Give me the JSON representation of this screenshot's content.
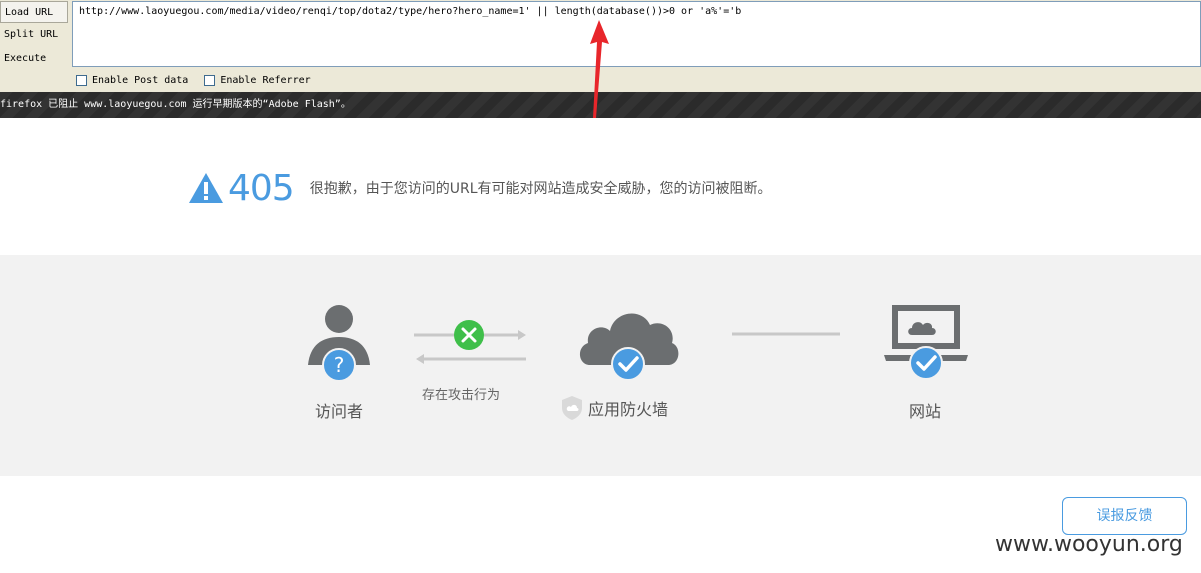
{
  "hackbar": {
    "load_url": "Load URL",
    "split_url": "Split URL",
    "execute": "Execute",
    "url_value": "http://www.laoyuegou.com/media/video/renqi/top/dota2/type/hero?hero_name=1'  || length(database())>0 or  'a%'='b",
    "enable_post": "Enable Post data",
    "enable_referrer": "Enable Referrer"
  },
  "flash_notice": "firefox 已阻止 www.laoyuegou.com 运行早期版本的“Adobe Flash”。",
  "error": {
    "code": "405",
    "message": "很抱歉，由于您访问的URL有可能对网站造成安全威胁，您的访问被阻断。"
  },
  "diagram": {
    "visitor_label": "访问者",
    "attack_label": "存在攻击行为",
    "firewall_label": "应用防火墙",
    "website_label": "网站"
  },
  "feedback_label": "误报反馈",
  "watermark": "www.wooyun.org",
  "colors": {
    "accent": "#4a9be0",
    "green": "#3fbf4a",
    "icon_gray": "#6b6e70",
    "arrow_red": "#e8262b"
  }
}
